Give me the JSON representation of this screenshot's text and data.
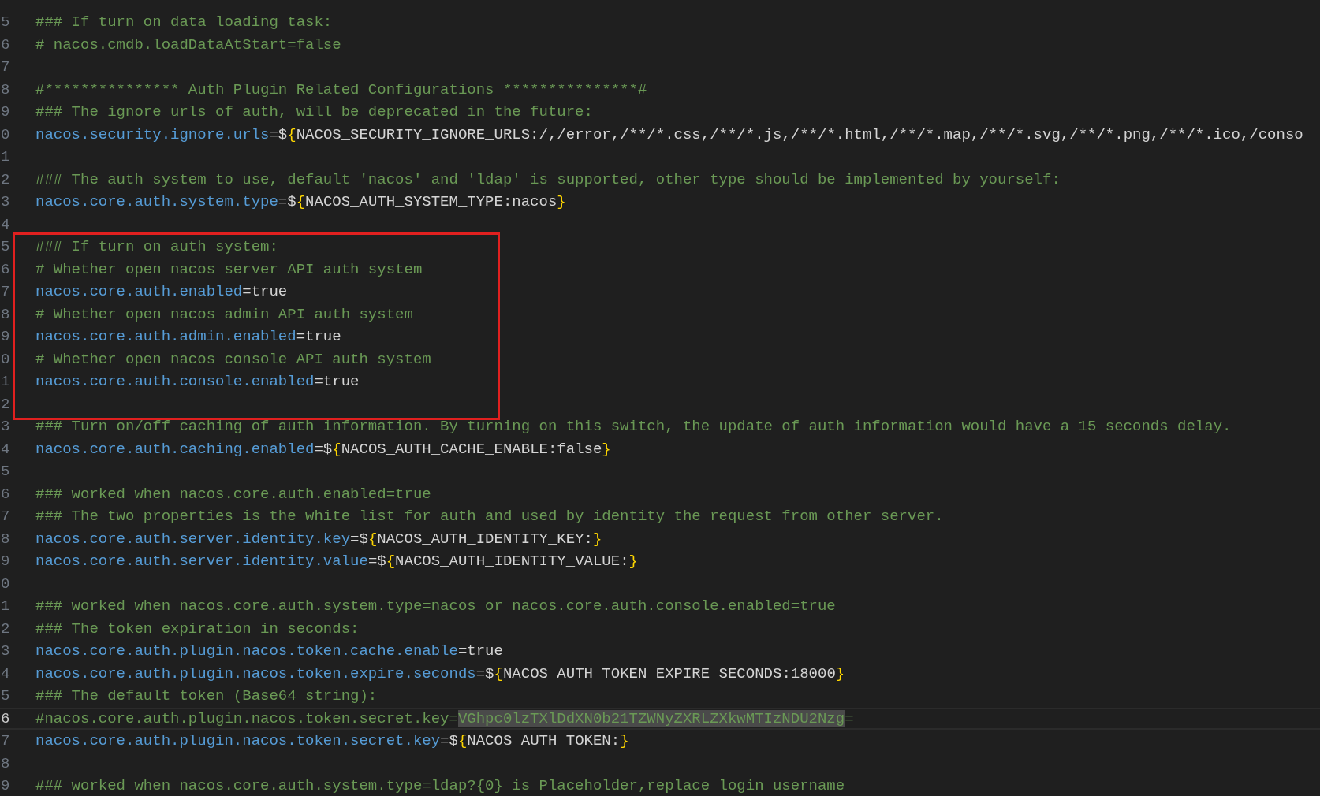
{
  "editor": {
    "blocks": [
      {
        "kind": "plain",
        "lines": [
          {
            "number": "5",
            "current": false,
            "tokens": [
              {
                "kind": "comment",
                "text": "### If turn on data loading task:"
              }
            ]
          },
          {
            "number": "6",
            "current": false,
            "tokens": [
              {
                "kind": "comment",
                "text": "# nacos.cmdb.loadDataAtStart=false"
              }
            ]
          },
          {
            "number": "7",
            "current": false
          },
          {
            "number": "8",
            "current": false,
            "tokens": [
              {
                "kind": "comment",
                "text": "#*************** Auth Plugin Related Configurations ***************#"
              }
            ]
          },
          {
            "number": "9",
            "current": false,
            "tokens": [
              {
                "kind": "comment",
                "text": "### The ignore urls of auth, will be deprecated in the future:"
              }
            ]
          },
          {
            "number": "0",
            "current": false,
            "tokens": [
              {
                "kind": "key",
                "text": "nacos.security.ignore.urls"
              },
              {
                "kind": "plain",
                "text": "=$"
              },
              {
                "kind": "brace",
                "text": "{"
              },
              {
                "kind": "plain",
                "text": "NACOS_SECURITY_IGNORE_URLS:/,/error,/**/*.css,/**/*.js,/**/*.html,/**/*.map,/**/*.svg,/**/*.png,/**/*.ico,/conso"
              }
            ]
          },
          {
            "number": "1",
            "current": false
          },
          {
            "number": "2",
            "current": false,
            "tokens": [
              {
                "kind": "comment",
                "text": "### The auth system to use, default 'nacos' and 'ldap' is supported, other type should be implemented by yourself:"
              }
            ]
          },
          {
            "number": "3",
            "current": false,
            "tokens": [
              {
                "kind": "key",
                "text": "nacos.core.auth.system.type"
              },
              {
                "kind": "plain",
                "text": "=$"
              },
              {
                "kind": "brace",
                "text": "{"
              },
              {
                "kind": "plain",
                "text": "NACOS_AUTH_SYSTEM_TYPE:nacos"
              },
              {
                "kind": "brace",
                "text": "}"
              }
            ]
          },
          {
            "number": "4",
            "current": false
          }
        ]
      },
      {
        "kind": "boxed",
        "lines": [
          {
            "number": "5",
            "current": false,
            "tokens": [
              {
                "kind": "comment",
                "text": "### If turn on auth system:"
              }
            ]
          },
          {
            "number": "6",
            "current": false,
            "tokens": [
              {
                "kind": "comment",
                "text": "# Whether open nacos server API auth system"
              }
            ]
          },
          {
            "number": "7",
            "current": false,
            "tokens": [
              {
                "kind": "key",
                "text": "nacos.core.auth.enabled"
              },
              {
                "kind": "plain",
                "text": "=true"
              }
            ]
          },
          {
            "number": "8",
            "current": false,
            "tokens": [
              {
                "kind": "comment",
                "text": "# Whether open nacos admin API auth system"
              }
            ]
          },
          {
            "number": "9",
            "current": false,
            "tokens": [
              {
                "kind": "key",
                "text": "nacos.core.auth.admin.enabled"
              },
              {
                "kind": "plain",
                "text": "=true"
              }
            ]
          },
          {
            "number": "0",
            "current": false,
            "tokens": [
              {
                "kind": "comment",
                "text": "# Whether open nacos console API auth system"
              }
            ]
          },
          {
            "number": "1",
            "current": false,
            "tokens": [
              {
                "kind": "key",
                "text": "nacos.core.auth.console.enabled"
              },
              {
                "kind": "plain",
                "text": "=true"
              }
            ]
          },
          {
            "number": "2",
            "current": false
          }
        ]
      },
      {
        "kind": "plain",
        "lines": [
          {
            "number": "3",
            "current": false,
            "tokens": [
              {
                "kind": "comment",
                "text": "### Turn on/off caching of auth information. By turning on this switch, the update of auth information would have a 15 seconds delay."
              }
            ]
          },
          {
            "number": "4",
            "current": false,
            "tokens": [
              {
                "kind": "key",
                "text": "nacos.core.auth.caching.enabled"
              },
              {
                "kind": "plain",
                "text": "=$"
              },
              {
                "kind": "brace",
                "text": "{"
              },
              {
                "kind": "plain",
                "text": "NACOS_AUTH_CACHE_ENABLE:false"
              },
              {
                "kind": "brace",
                "text": "}"
              }
            ]
          },
          {
            "number": "5",
            "current": false
          },
          {
            "number": "6",
            "current": false,
            "tokens": [
              {
                "kind": "comment",
                "text": "### worked when nacos.core.auth.enabled=true"
              }
            ]
          },
          {
            "number": "7",
            "current": false,
            "tokens": [
              {
                "kind": "comment",
                "text": "### The two properties is the white list for auth and used by identity the request from other server."
              }
            ]
          },
          {
            "number": "8",
            "current": false,
            "tokens": [
              {
                "kind": "key",
                "text": "nacos.core.auth.server.identity.key"
              },
              {
                "kind": "plain",
                "text": "=$"
              },
              {
                "kind": "brace",
                "text": "{"
              },
              {
                "kind": "plain",
                "text": "NACOS_AUTH_IDENTITY_KEY:"
              },
              {
                "kind": "brace",
                "text": "}"
              }
            ]
          },
          {
            "number": "9",
            "current": false,
            "tokens": [
              {
                "kind": "key",
                "text": "nacos.core.auth.server.identity.value"
              },
              {
                "kind": "plain",
                "text": "=$"
              },
              {
                "kind": "brace",
                "text": "{"
              },
              {
                "kind": "plain",
                "text": "NACOS_AUTH_IDENTITY_VALUE:"
              },
              {
                "kind": "brace",
                "text": "}"
              }
            ]
          },
          {
            "number": "0",
            "current": false
          },
          {
            "number": "1",
            "current": false,
            "tokens": [
              {
                "kind": "comment",
                "text": "### worked when nacos.core.auth.system.type=nacos or nacos.core.auth.console.enabled=true"
              }
            ]
          },
          {
            "number": "2",
            "current": false,
            "tokens": [
              {
                "kind": "comment",
                "text": "### The token expiration in seconds:"
              }
            ]
          },
          {
            "number": "3",
            "current": false,
            "tokens": [
              {
                "kind": "key",
                "text": "nacos.core.auth.plugin.nacos.token.cache.enable"
              },
              {
                "kind": "plain",
                "text": "=true"
              }
            ]
          },
          {
            "number": "4",
            "current": false,
            "tokens": [
              {
                "kind": "key",
                "text": "nacos.core.auth.plugin.nacos.token.expire.seconds"
              },
              {
                "kind": "plain",
                "text": "=$"
              },
              {
                "kind": "brace",
                "text": "{"
              },
              {
                "kind": "plain",
                "text": "NACOS_AUTH_TOKEN_EXPIRE_SECONDS:18000"
              },
              {
                "kind": "brace",
                "text": "}"
              }
            ]
          },
          {
            "number": "5",
            "current": false,
            "tokens": [
              {
                "kind": "comment",
                "text": "### The default token (Base64 string):"
              }
            ]
          },
          {
            "number": "6",
            "current": true,
            "tokens": [
              {
                "kind": "comment",
                "text": "#nacos.core.auth.plugin.nacos.token.secret.key="
              },
              {
                "kind": "selected",
                "text": "VGhpc0lzTXlDdXN0b21TZWNyZXRLZXkwMTIzNDU2Nzg"
              },
              {
                "kind": "comment",
                "text": "="
              }
            ]
          },
          {
            "number": "7",
            "current": false,
            "tokens": [
              {
                "kind": "key",
                "text": "nacos.core.auth.plugin.nacos.token.secret.key"
              },
              {
                "kind": "plain",
                "text": "=$"
              },
              {
                "kind": "brace",
                "text": "{"
              },
              {
                "kind": "plain",
                "text": "NACOS_AUTH_TOKEN:"
              },
              {
                "kind": "brace",
                "text": "}"
              }
            ]
          },
          {
            "number": "8",
            "current": false
          },
          {
            "number": "9",
            "current": false,
            "tokens": [
              {
                "kind": "comment",
                "text": "### worked when nacos.core.auth.system.type=ldap?{0} is Placeholder,replace login username"
              }
            ]
          }
        ]
      }
    ]
  }
}
